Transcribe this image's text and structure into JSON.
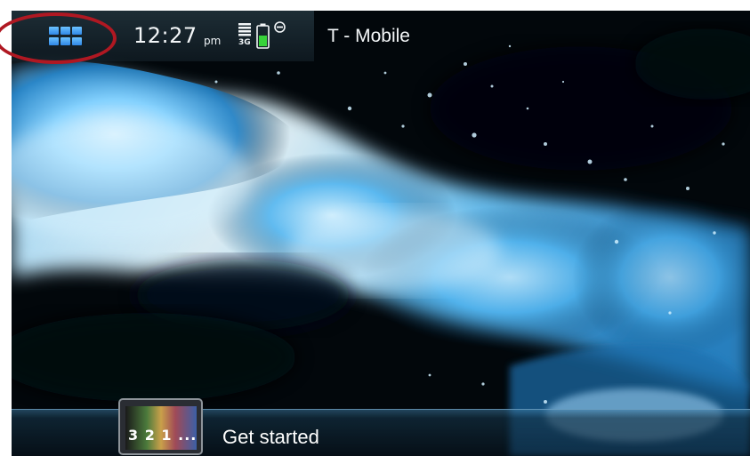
{
  "status_bar": {
    "menu_icon": "app-grid-icon",
    "time": "12:27",
    "ampm": "pm",
    "network_type": "3G",
    "signal_icon": "signal-strength-icon",
    "battery_icon": "battery-icon",
    "battery_level": 0.6,
    "minus_icon": "minus-circle-icon",
    "operator": "T - Mobile",
    "highlight_color": "#b01822"
  },
  "wallpaper": {
    "description_icon": "water-splash-wallpaper"
  },
  "bottom_bar": {
    "get_started_thumb_text": "3 2 1 ...",
    "get_started_label": "Get started"
  },
  "colors": {
    "accent_blue": "#4aa8f0",
    "text": "#ffffff"
  }
}
